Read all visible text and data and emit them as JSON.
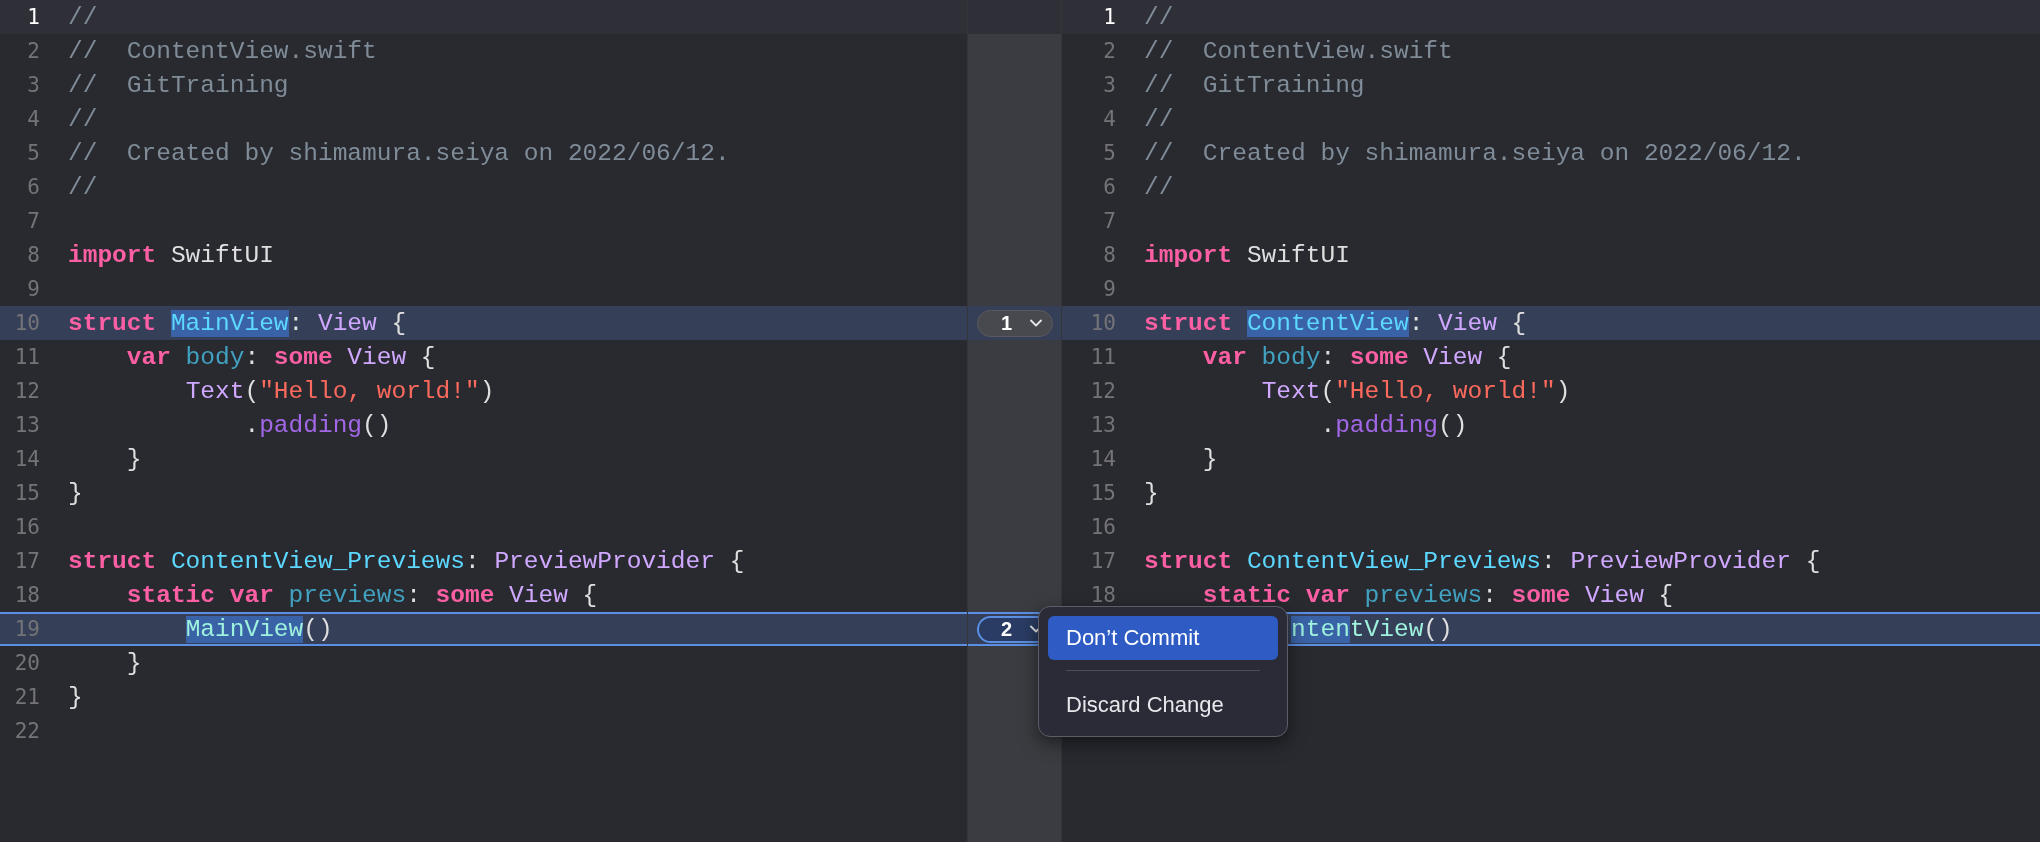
{
  "left_pane": {
    "lines": [
      {
        "number": "1",
        "current": true,
        "modified": false,
        "selected": false,
        "tokens": [
          {
            "text": "//",
            "kind": "comment",
            "changed": false
          }
        ]
      },
      {
        "number": "2",
        "current": false,
        "modified": false,
        "selected": false,
        "tokens": [
          {
            "text": "//  ContentView.swift",
            "kind": "comment",
            "changed": false
          }
        ]
      },
      {
        "number": "3",
        "current": false,
        "modified": false,
        "selected": false,
        "tokens": [
          {
            "text": "//  GitTraining",
            "kind": "comment",
            "changed": false
          }
        ]
      },
      {
        "number": "4",
        "current": false,
        "modified": false,
        "selected": false,
        "tokens": [
          {
            "text": "//",
            "kind": "comment",
            "changed": false
          }
        ]
      },
      {
        "number": "5",
        "current": false,
        "modified": false,
        "selected": false,
        "tokens": [
          {
            "text": "//  Created by shimamura.seiya on 2022/06/12.",
            "kind": "comment",
            "changed": false
          }
        ]
      },
      {
        "number": "6",
        "current": false,
        "modified": false,
        "selected": false,
        "tokens": [
          {
            "text": "//",
            "kind": "comment",
            "changed": false
          }
        ]
      },
      {
        "number": "7",
        "current": false,
        "modified": false,
        "selected": false
      },
      {
        "number": "8",
        "current": false,
        "modified": false,
        "selected": false,
        "tokens": [
          {
            "text": "import",
            "kind": "keyword",
            "changed": false
          },
          {
            "text": " SwiftUI",
            "kind": "plain",
            "changed": false
          }
        ]
      },
      {
        "number": "9",
        "current": false,
        "modified": false,
        "selected": false
      },
      {
        "number": "10",
        "current": false,
        "modified": true,
        "selected": false,
        "marker": {
          "label": "1",
          "selected": false
        },
        "tokens": [
          {
            "text": "struct",
            "kind": "keyword",
            "changed": false
          },
          {
            "text": " MainView",
            "kind": "type_decl",
            "changed": true
          },
          {
            "text": ":",
            "kind": "plain",
            "changed": false
          },
          {
            "text": " View",
            "kind": "type",
            "changed": false
          },
          {
            "text": " {",
            "kind": "plain",
            "changed": false
          }
        ]
      },
      {
        "number": "11",
        "current": false,
        "modified": false,
        "selected": false,
        "tokens": [
          {
            "text": "    var",
            "kind": "keyword",
            "changed": false
          },
          {
            "text": " body",
            "kind": "property",
            "changed": false
          },
          {
            "text": ":",
            "kind": "plain",
            "changed": false
          },
          {
            "text": " some",
            "kind": "keyword",
            "changed": false
          },
          {
            "text": " View",
            "kind": "type",
            "changed": false
          },
          {
            "text": " {",
            "kind": "plain",
            "changed": false
          }
        ]
      },
      {
        "number": "12",
        "current": false,
        "modified": false,
        "selected": false,
        "tokens": [
          {
            "text": "        Text",
            "kind": "type",
            "changed": false
          },
          {
            "text": "(",
            "kind": "plain",
            "changed": false
          },
          {
            "text": "\"Hello, world!\"",
            "kind": "string",
            "changed": false
          },
          {
            "text": ")",
            "kind": "plain",
            "changed": false
          }
        ]
      },
      {
        "number": "13",
        "current": false,
        "modified": false,
        "selected": false,
        "tokens": [
          {
            "text": "            .",
            "kind": "plain",
            "changed": false
          },
          {
            "text": "padding",
            "kind": "method",
            "changed": false
          },
          {
            "text": "()",
            "kind": "plain",
            "changed": false
          }
        ]
      },
      {
        "number": "14",
        "current": false,
        "modified": false,
        "selected": false,
        "tokens": [
          {
            "text": "    }",
            "kind": "plain",
            "changed": false
          }
        ]
      },
      {
        "number": "15",
        "current": false,
        "modified": false,
        "selected": false,
        "tokens": [
          {
            "text": "}",
            "kind": "plain",
            "changed": false
          }
        ]
      },
      {
        "number": "16",
        "current": false,
        "modified": false,
        "selected": false
      },
      {
        "number": "17",
        "current": false,
        "modified": false,
        "selected": false,
        "tokens": [
          {
            "text": "struct",
            "kind": "keyword",
            "changed": false
          },
          {
            "text": " ContentView_Previews",
            "kind": "type_decl",
            "changed": false
          },
          {
            "text": ":",
            "kind": "plain",
            "changed": false
          },
          {
            "text": " PreviewProvider",
            "kind": "type",
            "changed": false
          },
          {
            "text": " {",
            "kind": "plain",
            "changed": false
          }
        ]
      },
      {
        "number": "18",
        "current": false,
        "modified": false,
        "selected": false,
        "tokens": [
          {
            "text": "    static",
            "kind": "keyword",
            "changed": false
          },
          {
            "text": " var",
            "kind": "keyword",
            "changed": false
          },
          {
            "text": " previews",
            "kind": "property",
            "changed": false
          },
          {
            "text": ":",
            "kind": "plain",
            "changed": false
          },
          {
            "text": " some",
            "kind": "keyword",
            "changed": false
          },
          {
            "text": " View",
            "kind": "type",
            "changed": false
          },
          {
            "text": " {",
            "kind": "plain",
            "changed": false
          }
        ]
      },
      {
        "number": "19",
        "current": false,
        "modified": true,
        "selected": true,
        "marker": {
          "label": "2",
          "selected": true
        },
        "tokens": [
          {
            "text": "        MainView",
            "kind": "type_ref",
            "changed": true
          },
          {
            "text": "()",
            "kind": "plain",
            "changed": false
          }
        ]
      },
      {
        "number": "20",
        "current": false,
        "modified": false,
        "selected": false,
        "tokens": [
          {
            "text": "    }",
            "kind": "plain",
            "changed": false
          }
        ]
      },
      {
        "number": "21",
        "current": false,
        "modified": false,
        "selected": false,
        "tokens": [
          {
            "text": "}",
            "kind": "plain",
            "changed": false
          }
        ]
      },
      {
        "number": "22",
        "current": false,
        "modified": false,
        "selected": false
      }
    ]
  },
  "right_pane": {
    "lines": [
      {
        "number": "1",
        "current": true,
        "modified": false,
        "selected": false,
        "tokens": [
          {
            "text": "//",
            "kind": "comment",
            "changed": false
          }
        ]
      },
      {
        "number": "2",
        "current": false,
        "modified": false,
        "selected": false,
        "tokens": [
          {
            "text": "//  ContentView.swift",
            "kind": "comment",
            "changed": false
          }
        ]
      },
      {
        "number": "3",
        "current": false,
        "modified": false,
        "selected": false,
        "tokens": [
          {
            "text": "//  GitTraining",
            "kind": "comment",
            "changed": false
          }
        ]
      },
      {
        "number": "4",
        "current": false,
        "modified": false,
        "selected": false,
        "tokens": [
          {
            "text": "//",
            "kind": "comment",
            "changed": false
          }
        ]
      },
      {
        "number": "5",
        "current": false,
        "modified": false,
        "selected": false,
        "tokens": [
          {
            "text": "//  Created by shimamura.seiya on 2022/06/12.",
            "kind": "comment",
            "changed": false
          }
        ]
      },
      {
        "number": "6",
        "current": false,
        "modified": false,
        "selected": false,
        "tokens": [
          {
            "text": "//",
            "kind": "comment",
            "changed": false
          }
        ]
      },
      {
        "number": "7",
        "current": false,
        "modified": false,
        "selected": false
      },
      {
        "number": "8",
        "current": false,
        "modified": false,
        "selected": false,
        "tokens": [
          {
            "text": "import",
            "kind": "keyword",
            "changed": false
          },
          {
            "text": " SwiftUI",
            "kind": "plain",
            "changed": false
          }
        ]
      },
      {
        "number": "9",
        "current": false,
        "modified": false,
        "selected": false
      },
      {
        "number": "10",
        "current": false,
        "modified": true,
        "selected": false,
        "tokens": [
          {
            "text": "struct",
            "kind": "keyword",
            "changed": false
          },
          {
            "text": " ContentView",
            "kind": "type_decl",
            "changed": true
          },
          {
            "text": ":",
            "kind": "plain",
            "changed": false
          },
          {
            "text": " View",
            "kind": "type",
            "changed": false
          },
          {
            "text": " {",
            "kind": "plain",
            "changed": false
          }
        ]
      },
      {
        "number": "11",
        "current": false,
        "modified": false,
        "selected": false,
        "tokens": [
          {
            "text": "    var",
            "kind": "keyword",
            "changed": false
          },
          {
            "text": " body",
            "kind": "property",
            "changed": false
          },
          {
            "text": ":",
            "kind": "plain",
            "changed": false
          },
          {
            "text": " some",
            "kind": "keyword",
            "changed": false
          },
          {
            "text": " View",
            "kind": "type",
            "changed": false
          },
          {
            "text": " {",
            "kind": "plain",
            "changed": false
          }
        ]
      },
      {
        "number": "12",
        "current": false,
        "modified": false,
        "selected": false,
        "tokens": [
          {
            "text": "        Text",
            "kind": "type",
            "changed": false
          },
          {
            "text": "(",
            "kind": "plain",
            "changed": false
          },
          {
            "text": "\"Hello, world!\"",
            "kind": "string",
            "changed": false
          },
          {
            "text": ")",
            "kind": "plain",
            "changed": false
          }
        ]
      },
      {
        "number": "13",
        "current": false,
        "modified": false,
        "selected": false,
        "tokens": [
          {
            "text": "            .",
            "kind": "plain",
            "changed": false
          },
          {
            "text": "padding",
            "kind": "method",
            "changed": false
          },
          {
            "text": "()",
            "kind": "plain",
            "changed": false
          }
        ]
      },
      {
        "number": "14",
        "current": false,
        "modified": false,
        "selected": false,
        "tokens": [
          {
            "text": "    }",
            "kind": "plain",
            "changed": false
          }
        ]
      },
      {
        "number": "15",
        "current": false,
        "modified": false,
        "selected": false,
        "tokens": [
          {
            "text": "}",
            "kind": "plain",
            "changed": false
          }
        ]
      },
      {
        "number": "16",
        "current": false,
        "modified": false,
        "selected": false
      },
      {
        "number": "17",
        "current": false,
        "modified": false,
        "selected": false,
        "tokens": [
          {
            "text": "struct",
            "kind": "keyword",
            "changed": false
          },
          {
            "text": " ContentView_Previews",
            "kind": "type_decl",
            "changed": false
          },
          {
            "text": ":",
            "kind": "plain",
            "changed": false
          },
          {
            "text": " PreviewProvider",
            "kind": "type",
            "changed": false
          },
          {
            "text": " {",
            "kind": "plain",
            "changed": false
          }
        ]
      },
      {
        "number": "18",
        "current": false,
        "modified": false,
        "selected": false,
        "tokens": [
          {
            "text": "    static",
            "kind": "keyword",
            "changed": false
          },
          {
            "text": " var",
            "kind": "keyword",
            "changed": false
          },
          {
            "text": " previews",
            "kind": "property",
            "changed": false
          },
          {
            "text": ":",
            "kind": "plain",
            "changed": false
          },
          {
            "text": " some",
            "kind": "keyword",
            "changed": false
          },
          {
            "text": " View",
            "kind": "type",
            "changed": false
          },
          {
            "text": " {",
            "kind": "plain",
            "changed": false
          }
        ]
      },
      {
        "current": false,
        "modified": true,
        "selected": true,
        "tokens": [
          {
            "text": "          nten",
            "kind": "type_ref",
            "changed": true
          },
          {
            "text": "tView",
            "kind": "type_ref",
            "changed": false
          },
          {
            "text": "()",
            "kind": "plain",
            "changed": false
          }
        ]
      }
    ]
  },
  "context_menu": {
    "items": [
      {
        "label": "Don’t Commit",
        "selected": true
      },
      {
        "label": "Discard Change",
        "selected": false
      }
    ]
  }
}
